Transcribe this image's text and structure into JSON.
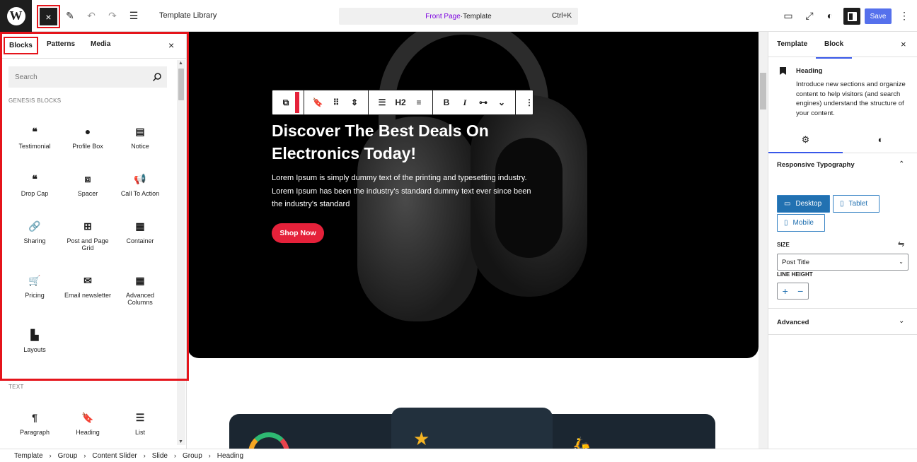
{
  "topbar": {
    "logo": "W",
    "toggle_icon": "×",
    "template_library": "Template Library",
    "command": {
      "page": "Front Page",
      "separator": " · ",
      "type": "Template",
      "shortcut": "Ctrl+K"
    },
    "save_label": "Save"
  },
  "inserter": {
    "tabs": [
      "Blocks",
      "Patterns",
      "Media"
    ],
    "close": "×",
    "search_placeholder": "Search",
    "categories": {
      "genesis": "GENESIS BLOCKS",
      "text": "TEXT"
    },
    "genesis_blocks": [
      {
        "label": "Testimonial",
        "icon": "quote-icon",
        "glyph": "❝"
      },
      {
        "label": "Profile Box",
        "icon": "user-icon",
        "glyph": "●"
      },
      {
        "label": "Notice",
        "icon": "notice-icon",
        "glyph": "▤"
      },
      {
        "label": "Drop Cap",
        "icon": "quote-icon",
        "glyph": "❝"
      },
      {
        "label": "Spacer",
        "icon": "spacer-icon",
        "glyph": "⧈"
      },
      {
        "label": "Call To Action",
        "icon": "megaphone-icon",
        "glyph": "📢"
      },
      {
        "label": "Sharing",
        "icon": "link-icon",
        "glyph": "🔗"
      },
      {
        "label": "Post and Page Grid",
        "icon": "grid-icon",
        "glyph": "⊞"
      },
      {
        "label": "Container",
        "icon": "container-icon",
        "glyph": "▦"
      },
      {
        "label": "Pricing",
        "icon": "cart-icon",
        "glyph": "🛒"
      },
      {
        "label": "Email newsletter",
        "icon": "email-icon",
        "glyph": "✉"
      },
      {
        "label": "Advanced Columns",
        "icon": "columns-icon",
        "glyph": "▦"
      },
      {
        "label": "Layouts",
        "icon": "layouts-icon",
        "glyph": "▙"
      }
    ],
    "text_blocks": [
      {
        "label": "Paragraph",
        "icon": "paragraph-icon",
        "glyph": "¶"
      },
      {
        "label": "Heading",
        "icon": "bookmark-icon",
        "glyph": "🔖"
      },
      {
        "label": "List",
        "icon": "list-icon",
        "glyph": "☰"
      }
    ]
  },
  "canvas": {
    "toolbar": {
      "heading_level": "H2"
    },
    "hero_title": "Discover The Best Deals On Electronics Today!",
    "hero_desc": "Lorem Ipsum is simply dummy text of the printing and typesetting industry. Lorem Ipsum has been the industry's standard dummy text ever since been the industry's standard",
    "shop_button": "Shop Now"
  },
  "sidebar": {
    "tabs": [
      "Template",
      "Block"
    ],
    "close": "×",
    "block_name": "Heading",
    "block_desc": "Introduce new sections and organize content to help visitors (and search engines) understand the structure of your content.",
    "section_title": "Responsive Typography",
    "devices": [
      "Desktop",
      "Tablet",
      "Mobile"
    ],
    "size_label": "SIZE",
    "size_value": "Post Title",
    "line_height_label": "LINE HEIGHT",
    "advanced": "Advanced"
  },
  "breadcrumb": [
    "Template",
    "Group",
    "Content Slider",
    "Slide",
    "Group",
    "Heading"
  ],
  "colors": {
    "accent": "#3858e9",
    "highlight": "#e5141b",
    "button": "#e5213a",
    "device_active": "#2271b1"
  }
}
